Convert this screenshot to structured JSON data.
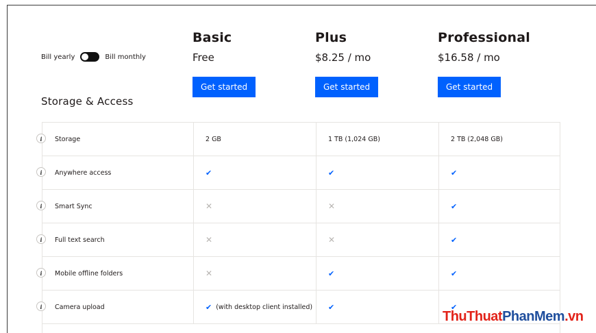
{
  "billing_toggle": {
    "yearly_label": "Bill yearly",
    "monthly_label": "Bill monthly",
    "selected": "yearly"
  },
  "plans": [
    {
      "name": "Basic",
      "price": "Free",
      "cta": "Get started"
    },
    {
      "name": "Plus",
      "price": "$8.25 / mo",
      "cta": "Get started"
    },
    {
      "name": "Professional",
      "price": "$16.58 / mo",
      "cta": "Get started"
    }
  ],
  "section_title": "Storage & Access",
  "info_glyph": "i",
  "rows": [
    {
      "feature": "Storage",
      "basic": "2 GB",
      "plus": "1 TB (1,024 GB)",
      "professional": "2 TB (2,048 GB)"
    },
    {
      "feature": "Anywhere access",
      "basic": "check",
      "plus": "check",
      "professional": "check"
    },
    {
      "feature": "Smart Sync",
      "basic": "cross",
      "plus": "cross",
      "professional": "check"
    },
    {
      "feature": "Full text search",
      "basic": "cross",
      "plus": "cross",
      "professional": "check"
    },
    {
      "feature": "Mobile offline folders",
      "basic": "cross",
      "plus": "check",
      "professional": "check"
    },
    {
      "feature": "Camera upload",
      "basic": "check",
      "basic_note": "(with desktop client installed)",
      "plus": "check",
      "professional": "check"
    }
  ],
  "glyphs": {
    "check": "✔",
    "cross": "✕"
  },
  "colors": {
    "accent": "#0061fe",
    "check": "#0061fe",
    "cross": "#b8b5b2"
  },
  "watermark": {
    "part1": "ThuThuat",
    "part2": "PhanMem",
    "part3": ".vn"
  }
}
